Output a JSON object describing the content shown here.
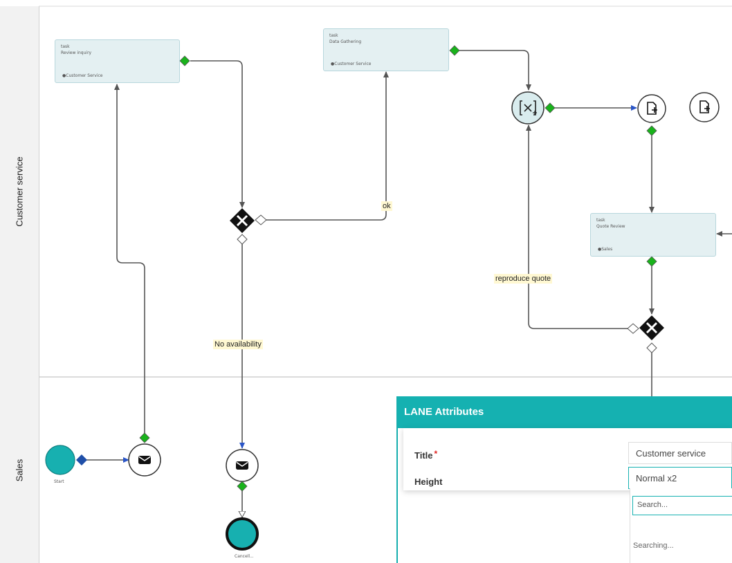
{
  "lanes": [
    {
      "title": "Customer service"
    },
    {
      "title": "Sales"
    }
  ],
  "tasks": [
    {
      "id": "review",
      "type": "task",
      "name": "Review inquiry",
      "lane": "Customer Service"
    },
    {
      "id": "gather",
      "type": "task",
      "name": "Data Gathering",
      "lane": "Customer Service"
    },
    {
      "id": "quote",
      "type": "task",
      "name": "Quote Review",
      "lane": "Sales"
    }
  ],
  "edge_labels": {
    "ok": "ok",
    "no_availability": "No availability",
    "reproduce_quote": "reproduce quote"
  },
  "events": {
    "start": "Start",
    "cancel": "Cancell..."
  },
  "colors": {
    "teal": "#17b0b0",
    "connector_green": "#19b21b",
    "connector_blue": "#1f4fa8",
    "arrow_blue": "#2a55c7",
    "task_fill": "#e4f0f2"
  },
  "panel": {
    "title": "LANE Attributes",
    "title_label": "Title",
    "required_mark": "*",
    "title_value": "Customer service",
    "height_label": "Height",
    "height_value": "Normal x2",
    "search_placeholder": "Search...",
    "searching_text": "Searching..."
  }
}
